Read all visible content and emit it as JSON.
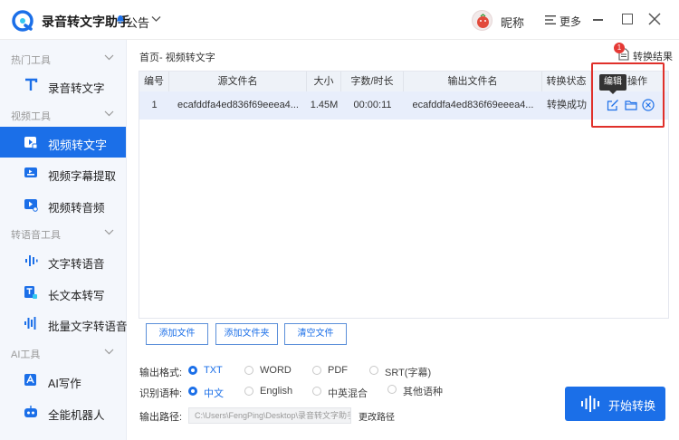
{
  "app": {
    "title": "录音转文字助手",
    "notice": "公告",
    "nickname": "昵称",
    "more": "更多"
  },
  "breadcrumb": "首页- 视频转文字",
  "result": {
    "label": "转换结果",
    "badge": "1"
  },
  "sidebar": {
    "sections": [
      {
        "title": "热门工具",
        "items": [
          {
            "label": "录音转文字"
          }
        ]
      },
      {
        "title": "视频工具",
        "items": [
          {
            "label": "视频转文字"
          },
          {
            "label": "视频字幕提取"
          },
          {
            "label": "视频转音频"
          }
        ]
      },
      {
        "title": "转语音工具",
        "items": [
          {
            "label": "文字转语音"
          },
          {
            "label": "长文本转写"
          },
          {
            "label": "批量文字转语音"
          }
        ]
      },
      {
        "title": "AI工具",
        "items": [
          {
            "label": "AI写作"
          },
          {
            "label": "全能机器人"
          }
        ]
      }
    ]
  },
  "table": {
    "headers": [
      "编号",
      "源文件名",
      "大小",
      "字数/时长",
      "输出文件名",
      "转换状态",
      "操作"
    ],
    "rows": [
      {
        "index": "1",
        "source": "ecafddfa4ed836f69eeea4...",
        "size": "1.45M",
        "duration": "00:00:11",
        "output": "ecafddfa4ed836f69eeea4...",
        "status": "转换成功"
      }
    ],
    "tooltip": "编辑"
  },
  "actions": {
    "add_file": "添加文件",
    "add_folder": "添加文件夹",
    "clear": "清空文件"
  },
  "output_format": {
    "label": "输出格式:",
    "options": [
      "TXT",
      "WORD",
      "PDF",
      "SRT(字幕)"
    ],
    "selected": "TXT"
  },
  "language": {
    "label": "识别语种:",
    "options": [
      "中文",
      "English",
      "中英混合",
      "其他语种"
    ],
    "selected": "中文"
  },
  "output_path": {
    "label": "输出路径:",
    "value": "C:\\Users\\FengPing\\Desktop\\录音转文字助手",
    "change": "更改路径"
  },
  "start_button": "开始转换",
  "colors": {
    "accent": "#1b6fe8",
    "highlight": "#e0302a",
    "sidebar_bg": "#f4f7fc"
  }
}
